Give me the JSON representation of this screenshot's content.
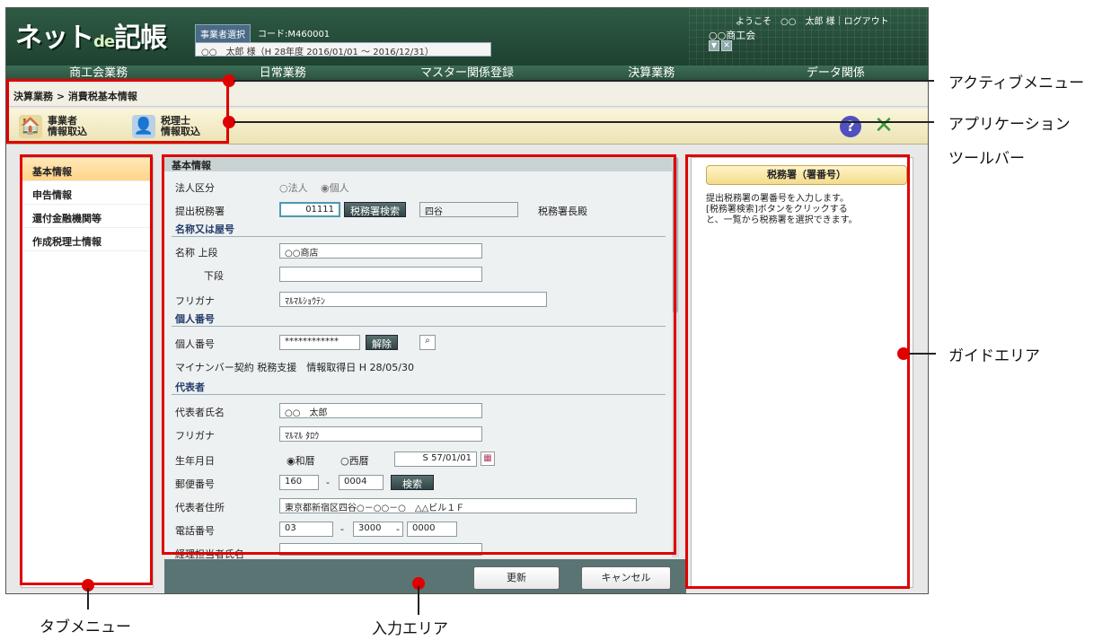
{
  "header": {
    "logo_main": "ネット",
    "logo_de": "de",
    "logo_tail": "記帳",
    "select_button": "事業者選択",
    "code": "コード:M460001",
    "period": "○○　太郎 様（H 28年度 2016/01/01 ～ 2016/12/31）",
    "welcome": "ようこそ　○○　太郎 様｜ログアウト",
    "org": "○○商工会"
  },
  "menubar": [
    "商工会業務",
    "日常業務",
    "マスター関係登録",
    "決算業務",
    "データ関係"
  ],
  "breadcrumb": "決算業務 > 消費税基本情報",
  "toolbar": {
    "btn1": "事業者\n情報取込",
    "btn2": "税理士\n情報取込"
  },
  "tabs": [
    "基本情報",
    "申告情報",
    "還付金融機関等",
    "作成税理士情報"
  ],
  "form": {
    "section_basic": "基本情報",
    "corp_label": "法人区分",
    "corp_opt1": "○法人",
    "corp_opt2": "◉個人",
    "tax_office_label": "提出税務署",
    "tax_office_code": "01111",
    "tax_office_search": "税務署検索",
    "tax_office_name": "四谷",
    "tax_office_suffix": "税務署長殿",
    "section_name": "名称又は屋号",
    "name_upper_label": "名称 上段",
    "name_upper_value": "○○商店",
    "name_lower_label": "下段",
    "name_lower_value": "",
    "furigana_label": "フリガナ",
    "furigana_value": "ﾏﾙﾏﾙｼｮｳﾃﾝ",
    "section_mynumber": "個人番号",
    "mynumber_label": "個人番号",
    "mynumber_value": "************",
    "mynumber_clear": "解除",
    "mynumber_info": "マイナンバー契約 税務支援　情報取得日 H 28/05/30",
    "section_rep": "代表者",
    "rep_name_label": "代表者氏名",
    "rep_name_value": "○○　太郎",
    "rep_kana_label": "フリガナ",
    "rep_kana_value": "ﾏﾙﾏﾙ ﾀﾛｳ",
    "birth_label": "生年月日",
    "birth_opt1": "◉和暦",
    "birth_opt2": "○西暦",
    "birth_value": "S 57/01/01",
    "zip_label": "郵便番号",
    "zip1": "160",
    "zip_dash": "-",
    "zip2": "0004",
    "zip_search": "検索",
    "addr_label": "代表者住所",
    "addr_value": "東京都新宿区四谷○－○○－○　△△ビル１Ｆ",
    "tel_label": "電話番号",
    "tel1": "03",
    "tel2": "3000",
    "tel3": "0000",
    "accountant_label": "経理担当者氏名",
    "accountant_value": ""
  },
  "footer": {
    "update": "更新",
    "cancel": "キャンセル"
  },
  "guide": {
    "title": "税務署（署番号）",
    "text": "提出税務署の署番号を入力します。\n[税務署検索]ボタンをクリックする\nと、一覧から税務署を選択できます。"
  },
  "callouts": {
    "active_menu": "アクティブメニュー",
    "app_toolbar_1": "アプリケーション",
    "app_toolbar_2": "ツールバー",
    "guide_area": "ガイドエリア",
    "tab_menu": "タブメニュー",
    "input_area": "入力エリア"
  },
  "colors": {
    "annotation_red": "#e00000",
    "header_green": "#2e5a44"
  }
}
